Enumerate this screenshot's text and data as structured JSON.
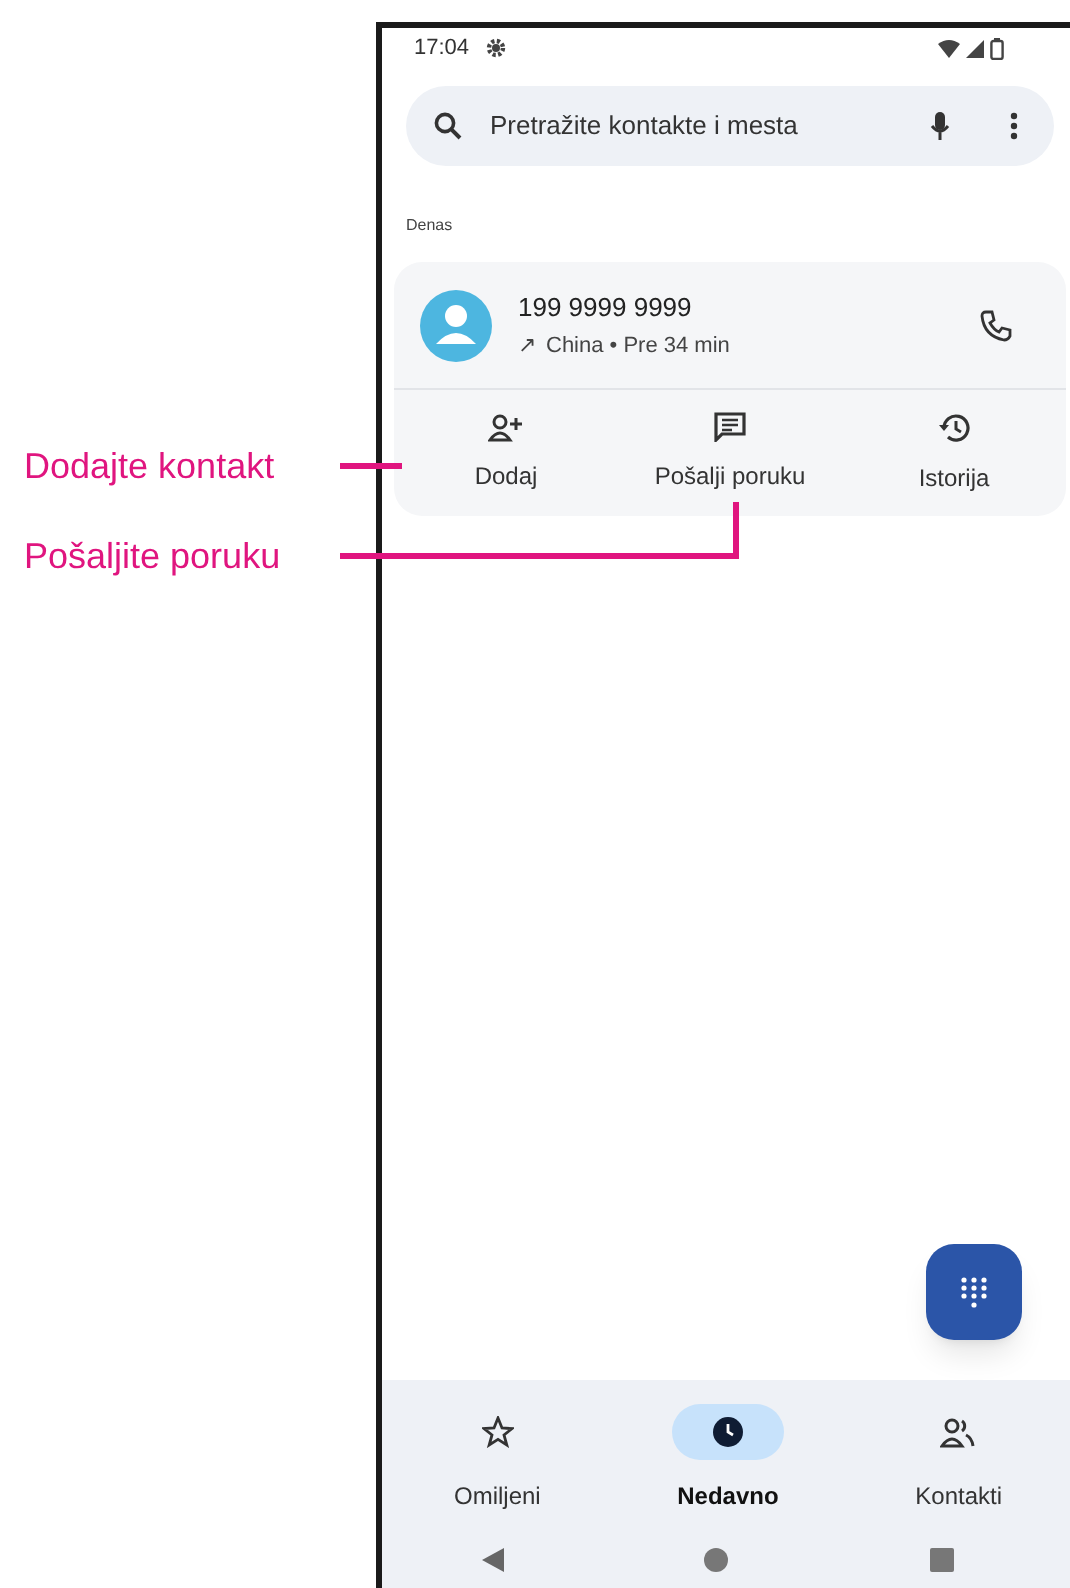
{
  "callouts": [
    {
      "text": "Dodajte kontakt"
    },
    {
      "text": "Pošaljite poruku"
    }
  ],
  "status_bar": {
    "time": "17:04"
  },
  "search": {
    "placeholder": "Pretražite kontakte i mesta"
  },
  "section_label": "Denas",
  "call": {
    "number": "199 9999 9999",
    "direction_icon": "↗",
    "detail": "China • Pre 34 min"
  },
  "actions": [
    {
      "kind": "add",
      "label": "Dodaj"
    },
    {
      "kind": "message",
      "label": "Pošalji poruku"
    },
    {
      "kind": "history",
      "label": "Istorija"
    }
  ],
  "nav": [
    {
      "kind": "favorites",
      "label": "Omiljeni",
      "selected": false
    },
    {
      "kind": "recents",
      "label": "Nedavno",
      "selected": true
    },
    {
      "kind": "contacts",
      "label": "Kontakti",
      "selected": false
    }
  ]
}
